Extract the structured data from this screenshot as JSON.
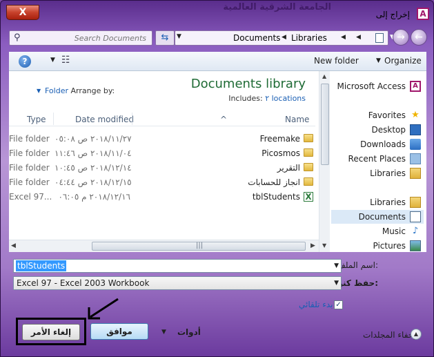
{
  "window": {
    "title": "إخراج إلى",
    "close_label": "X",
    "background_text": "الجامعة الشرقية العالمية",
    "app_icon_letter": "A"
  },
  "address": {
    "search_placeholder": "Search Documents",
    "breadcrumbs": [
      "Libraries",
      "Documents"
    ]
  },
  "toolbar": {
    "organize": "Organize",
    "new_folder": "New folder",
    "help": "?"
  },
  "library": {
    "title": "Documents library",
    "includes_label": "Includes:",
    "includes_count": "٢ locations",
    "arrange_label": "Arrange by:",
    "arrange_value": "Folder"
  },
  "columns": {
    "name": "Name",
    "date_modified": "Date modified",
    "type": "Type"
  },
  "files": [
    {
      "name": "Freemake",
      "date": "٢٠١٨/١١/٢٧ ص ٠٥:٠٨",
      "type": "File folder",
      "icon": "folder-icon"
    },
    {
      "name": "Picosmos",
      "date": "٢٠١٨/١١/٠٤ ص ١١:٤٦",
      "type": "File folder",
      "icon": "folder-icon"
    },
    {
      "name": "التقرير",
      "date": "٢٠١٨/١٢/١٤ ص ١٠:٤٥",
      "type": "File folder",
      "icon": "folder-icon"
    },
    {
      "name": "انجاز للحسابات",
      "date": "٢٠١٨/١٢/١٥ ص ٠٤:٤٤",
      "type": "File folder",
      "icon": "folder-icon"
    },
    {
      "name": "tblStudents",
      "date": "٢٠١٨/١٢/١٦ م ٠٦:٠٥",
      "type": "Excel 97...",
      "icon": "excel-icon"
    }
  ],
  "nav": {
    "items": [
      {
        "label": "Microsoft Access",
        "icon": "access-icon"
      },
      {
        "label": "Favorites",
        "icon": "star-icon"
      },
      {
        "label": "Desktop",
        "icon": "desktop-icon"
      },
      {
        "label": "Downloads",
        "icon": "downloads-icon"
      },
      {
        "label": "Recent Places",
        "icon": "recent-places-icon"
      },
      {
        "label": "Libraries",
        "icon": "libraries-icon"
      },
      {
        "label": "Libraries",
        "icon": "libraries-icon"
      },
      {
        "label": "Documents",
        "icon": "documents-icon"
      },
      {
        "label": "Music",
        "icon": "music-icon"
      },
      {
        "label": "Pictures",
        "icon": "pictures-icon"
      }
    ],
    "selected_index": 7
  },
  "form": {
    "file_name_label": "اسم الملف:",
    "file_name_value": "tblStudents",
    "save_type_label": "حفظ كنوع:",
    "save_type_value": "Excel 97 - Excel 2003 Workbook",
    "thumbnails_label": "بدء تلقائي",
    "thumbnails_checked": true,
    "hide_folders": "إخفاء المجلدات",
    "tools": "أدوات",
    "ok": "موافق",
    "cancel": "إلغاء الأمر"
  },
  "colors": {
    "accent": "#1a5fb4",
    "library_title": "#1f6b35",
    "frame": "#8b5dc0"
  }
}
